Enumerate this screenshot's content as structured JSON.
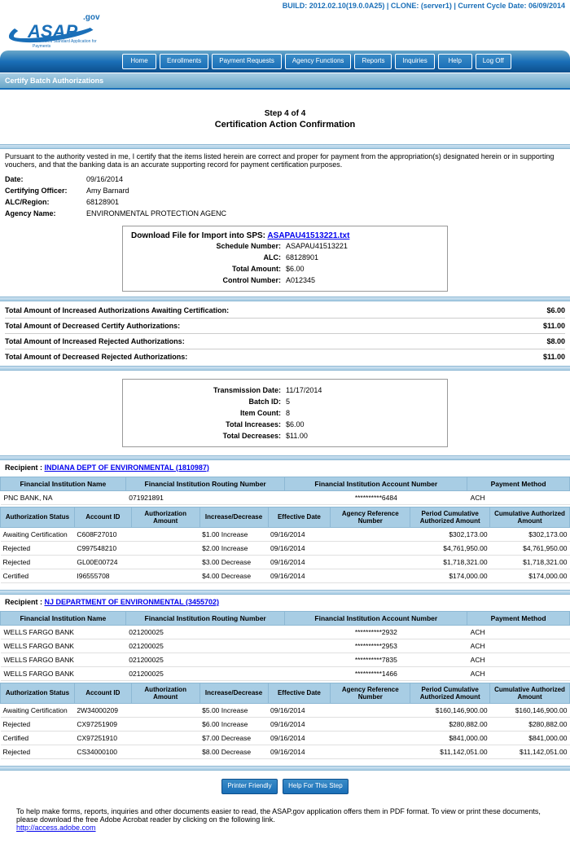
{
  "build_info": "BUILD: 2012.02.10(19.0.0A25) | CLONE: (server1) | Current Cycle Date: 06/09/2014",
  "logo": {
    "text": "ASAP",
    "suffix": ".gov",
    "tagline": "Automated Standard Application for Payments"
  },
  "nav": [
    "Home",
    "Enrollments",
    "Payment Requests",
    "Agency Functions",
    "Reports",
    "Inquiries",
    "Help",
    "Log Off"
  ],
  "page_bar": "Certify Batch Authorizations",
  "step": "Step 4 of 4",
  "page_title": "Certification Action Confirmation",
  "cert_statement": "Pursuant to the authority vested in me, I certify that the items listed herein are correct and proper for payment from the appropriation(s) designated herein or in supporting vouchers, and that the banking data is an accurate supporting record for payment certification purposes.",
  "header_kv": {
    "date_label": "Date:",
    "date": "09/16/2014",
    "officer_label": "Certifying Officer:",
    "officer": "Amy Barnard",
    "alc_label": "ALC/Region:",
    "alc": "68128901",
    "agency_label": "Agency Name:",
    "agency": "ENVIRONMENTAL PROTECTION AGENC"
  },
  "download": {
    "title_prefix": "Download File for Import into SPS:",
    "filename": "ASAPAU41513221.txt",
    "rows": [
      {
        "label": "Schedule Number:",
        "value": "ASAPAU41513221"
      },
      {
        "label": "ALC:",
        "value": "68128901"
      },
      {
        "label": "Total Amount:",
        "value": "$6.00"
      },
      {
        "label": "Control Number:",
        "value": "A012345"
      }
    ]
  },
  "totals": [
    {
      "label": "Total Amount of Increased Authorizations Awaiting Certification:",
      "value": "$6.00"
    },
    {
      "label": "Total Amount of Decreased Certify Authorizations:",
      "value": "$11.00"
    },
    {
      "label": "Total Amount of Increased Rejected Authorizations:",
      "value": "$8.00"
    },
    {
      "label": "Total Amount of Decreased Rejected Authorizations:",
      "value": "$11.00"
    }
  ],
  "transmission": {
    "rows": [
      {
        "label": "Transmission Date:",
        "value": "11/17/2014"
      },
      {
        "label": "Batch ID:",
        "value": "5"
      },
      {
        "label": "Item Count:",
        "value": "8"
      },
      {
        "label": "Total Increases:",
        "value": "$6.00"
      },
      {
        "label": "Total Decreases:",
        "value": "$11.00"
      }
    ]
  },
  "recipient_label": "Recipient :",
  "fi_headers": [
    "Financial Institution Name",
    "Financial Institution Routing Number",
    "Financial Institution Account Number",
    "Payment Method"
  ],
  "auth_headers": [
    "Authorization Status",
    "Account ID",
    "Authorization Amount",
    "Increase/Decrease",
    "Effective Date",
    "Agency Reference Number",
    "Period Cumulative Authorized Amount",
    "Cumulative Authorized Amount"
  ],
  "recipients": [
    {
      "name": "INDIANA DEPT OF ENVIRONMENTAL (1810987)",
      "fi": [
        {
          "name": "PNC BANK, NA",
          "routing": "071921891",
          "account": "**********6484",
          "method": "ACH"
        }
      ],
      "auth": [
        {
          "status": "Awaiting Certification",
          "acct": "C608F27010",
          "amt": "",
          "incdec": "$1.00 Increase",
          "eff": "09/16/2014",
          "ref": "",
          "pcum": "$302,173.00",
          "cum": "$302,173.00"
        },
        {
          "status": "Rejected",
          "acct": "C997548210",
          "amt": "",
          "incdec": "$2.00 Increase",
          "eff": "09/16/2014",
          "ref": "",
          "pcum": "$4,761,950.00",
          "cum": "$4,761,950.00"
        },
        {
          "status": "Rejected",
          "acct": "GL00E00724",
          "amt": "",
          "incdec": "$3.00 Decrease",
          "eff": "09/16/2014",
          "ref": "",
          "pcum": "$1,718,321.00",
          "cum": "$1,718,321.00"
        },
        {
          "status": "Certified",
          "acct": "I96555708",
          "amt": "",
          "incdec": "$4.00 Decrease",
          "eff": "09/16/2014",
          "ref": "",
          "pcum": "$174,000.00",
          "cum": "$174,000.00"
        }
      ]
    },
    {
      "name": "NJ DEPARTMENT OF ENVIRONMENTAL (3455702)",
      "fi": [
        {
          "name": "WELLS FARGO BANK",
          "routing": "021200025",
          "account": "**********2932",
          "method": "ACH"
        },
        {
          "name": "WELLS FARGO BANK",
          "routing": "021200025",
          "account": "**********2953",
          "method": "ACH"
        },
        {
          "name": "WELLS FARGO BANK",
          "routing": "021200025",
          "account": "**********7835",
          "method": "ACH"
        },
        {
          "name": "WELLS FARGO BANK",
          "routing": "021200025",
          "account": "**********1466",
          "method": "ACH"
        }
      ],
      "auth": [
        {
          "status": "Awaiting Certification",
          "acct": "2W34000209",
          "amt": "",
          "incdec": "$5.00 Increase",
          "eff": "09/16/2014",
          "ref": "",
          "pcum": "$160,146,900.00",
          "cum": "$160,146,900.00"
        },
        {
          "status": "Rejected",
          "acct": "CX97251909",
          "amt": "",
          "incdec": "$6.00 Increase",
          "eff": "09/16/2014",
          "ref": "",
          "pcum": "$280,882.00",
          "cum": "$280,882.00"
        },
        {
          "status": "Certified",
          "acct": "CX97251910",
          "amt": "",
          "incdec": "$7.00 Decrease",
          "eff": "09/16/2014",
          "ref": "",
          "pcum": "$841,000.00",
          "cum": "$841,000.00"
        },
        {
          "status": "Rejected",
          "acct": "CS34000100",
          "amt": "",
          "incdec": "$8.00 Decrease",
          "eff": "09/16/2014",
          "ref": "",
          "pcum": "$11,142,051.00",
          "cum": "$11,142,051.00"
        }
      ]
    }
  ],
  "buttons": {
    "printer": "Printer Friendly",
    "help": "Help For This Step"
  },
  "footer": {
    "text": "To help make forms, reports, inquiries and other documents easier to read, the ASAP.gov application offers them in PDF format. To view or print these documents, please download the free Adobe Acrobat reader by clicking on the following link.",
    "link": "http://access.adobe.com"
  }
}
